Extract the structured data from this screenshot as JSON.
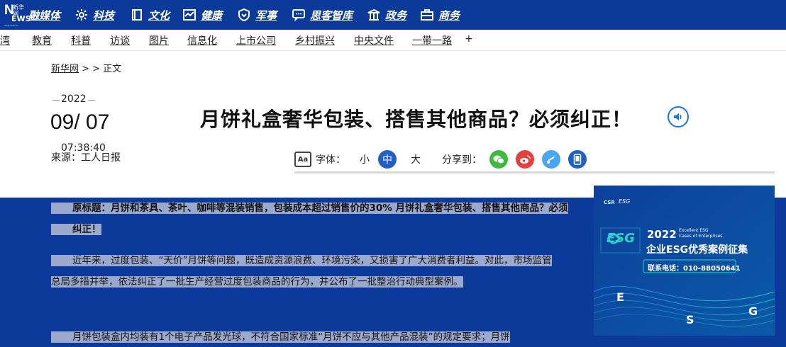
{
  "topnav": {
    "logo": {
      "big": "N",
      "xinhua": "新华网",
      "news": "EWS",
      "url": "www.news.cn"
    },
    "items": [
      {
        "label": "融媒体",
        "icon": "media-icon"
      },
      {
        "label": "科技",
        "icon": "tech-icon"
      },
      {
        "label": "文化",
        "icon": "culture-icon"
      },
      {
        "label": "健康",
        "icon": "health-icon"
      },
      {
        "label": "军事",
        "icon": "military-icon"
      },
      {
        "label": "思客智库",
        "icon": "thinktank-icon"
      },
      {
        "label": "政务",
        "icon": "government-icon"
      },
      {
        "label": "商务",
        "icon": "business-icon"
      }
    ]
  },
  "subnav": {
    "items": [
      "台湾",
      "教育",
      "科普",
      "访谈",
      "图片",
      "信息化",
      "上市公司",
      "乡村振兴",
      "中央文件",
      "一带一路"
    ],
    "plus": "+"
  },
  "breadcrumb": {
    "home": "新华网",
    "sep": " > > ",
    "current": "正文"
  },
  "meta": {
    "year": "2022",
    "date": "09/ 07",
    "time": "07:38:40",
    "source": "来源：工人日报"
  },
  "article": {
    "title": "月饼礼盒奢华包装、搭售其他商品？必须纠正！",
    "paragraphs": [
      "原标题：月饼和茶具、茶叶、咖啡等混装销售，包装成本超过销售价的30% 月饼礼盒奢华包装、搭售其他商品？必须纠正！",
      "近年来，过度包装、“天价”月饼等问题，既造成资源浪费、环境污染，又损害了广大消费者利益。对此，市场监管总局多措并举，依法纠正了一批生产经营过度包装商品的行为，并公布了一批整治行动典型案例。",
      "月饼包装盒内均装有1个电子产品发光球，不符合国家标准“月饼不应与其他产品混装”的规定要求；月饼"
    ]
  },
  "tools": {
    "font_label": "字体：",
    "small": "小",
    "medium": "中",
    "large": "大",
    "share_label": "分享到：",
    "aa": "Aa"
  },
  "ad": {
    "csr": "CSR",
    "esg_small": "ESG",
    "year": "2022",
    "en1": "Excellent ESG",
    "en2": "Cases of Enterprises",
    "cn": "企业ESG优秀案例征集",
    "phone": "联系电话：010-88050641",
    "letters": [
      "E",
      "S",
      "G"
    ],
    "colors": {
      "bg": "#0b4aa0",
      "accent": "#2ad3c8"
    }
  }
}
